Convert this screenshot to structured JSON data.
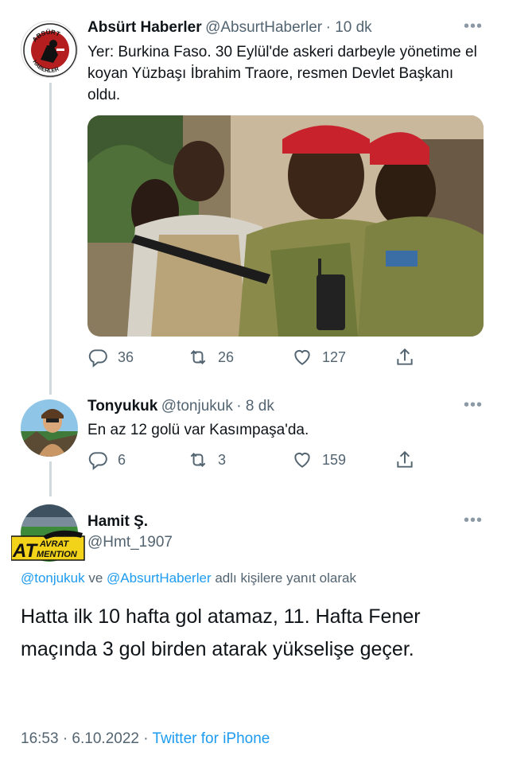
{
  "tweet1": {
    "author_name": "Absürt Haberler",
    "handle": "@AbsurtHaberler",
    "time": "· 10 dk",
    "text": "Yer: Burkina Faso. 30 Eylül'de askeri darbeyle yönetime el koyan Yüzbaşı İbrahim Traore, resmen Devlet Başkanı oldu.",
    "avatar_text_top": "ABSÜRT",
    "avatar_text_bottom": "HABERLER",
    "replies": "36",
    "retweets": "26",
    "likes": "127"
  },
  "tweet2": {
    "author_name": "Tonyukuk",
    "handle": "@tonjukuk",
    "time": "· 8 dk",
    "text": "En az 12 golü var Kasımpaşa'da.",
    "replies": "6",
    "retweets": "3",
    "likes": "159"
  },
  "tweet3": {
    "author_name": "Hamit Ş.",
    "handle": "@Hmt_1907",
    "avatar_badge_line1": "AVRAT",
    "avatar_badge_big": "AT",
    "avatar_badge_line2": "MENTION",
    "reply_mention1": "@tonjukuk",
    "reply_and": "ve",
    "reply_mention2": "@AbsurtHaberler",
    "reply_suffix": "adlı kişilere yanıt olarak",
    "text": "Hatta ilk 10 hafta gol atamaz, 11. Hafta Fener maçında 3 gol birden atarak yükselişe geçer.",
    "timestamp": "16:53 · 6.10.2022 ·",
    "source": "Twitter for iPhone"
  },
  "icons": [
    "reply-icon",
    "retweet-icon",
    "like-icon",
    "share-icon",
    "more-icon"
  ],
  "colors": {
    "link": "#1d9bf0",
    "muted": "#536471",
    "thread": "#cfd9de",
    "beret": "#c8232c"
  }
}
